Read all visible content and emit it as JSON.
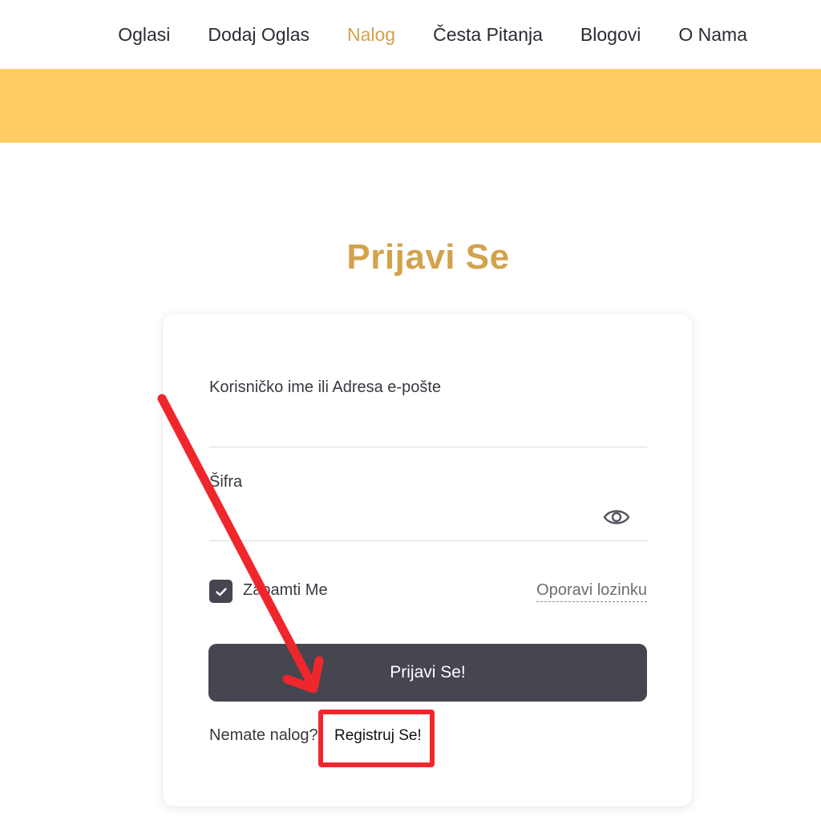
{
  "nav": {
    "items": [
      {
        "label": "Oglasi",
        "active": false
      },
      {
        "label": "Dodaj Oglas",
        "active": false
      },
      {
        "label": "Nalog",
        "active": true
      },
      {
        "label": "Česta Pitanja",
        "active": false
      },
      {
        "label": "Blogovi",
        "active": false
      },
      {
        "label": "O Nama",
        "active": false
      }
    ]
  },
  "colors": {
    "accent": "#d1a14c",
    "banner": "#ffcb64",
    "button": "#45464f",
    "annotation": "#f0262d"
  },
  "login": {
    "title": "Prijavi Se",
    "username_label": "Korisničko ime ili Adresa e-pošte",
    "username_value": "",
    "password_label": "Šifra",
    "password_value": "",
    "password_toggle_icon": "eye-icon",
    "remember_label": "Zapamti Me",
    "remember_checked": true,
    "forgot_label": "Oporavi lozinku",
    "submit_label": "Prijavi Se!",
    "no_account_text": "Nemate nalog?",
    "register_label": "Registruj Se!"
  },
  "annotation": {
    "type": "arrow-and-highlight",
    "target": "register-link"
  }
}
